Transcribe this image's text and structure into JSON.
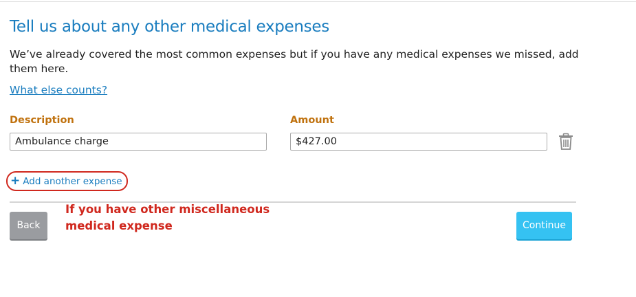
{
  "page": {
    "title": "Tell us about any other medical expenses",
    "intro": "We’ve already covered the most common expenses but if you have any medical expenses we missed, add them here.",
    "help_link": "What else counts?"
  },
  "form": {
    "description_label": "Description",
    "amount_label": "Amount",
    "description_value": "Ambulance charge",
    "amount_value": "$427.00",
    "delete_icon": "trash-icon",
    "add_icon": "plus-icon",
    "add_label": "Add another expense"
  },
  "annotation": {
    "text": "If you have other miscellaneous medical expense",
    "color": "#d0281e"
  },
  "footer": {
    "back_label": "Back",
    "continue_label": "Continue"
  },
  "colors": {
    "accent": "#1a7dbf",
    "label": "#c0720f",
    "continue_bg": "#35c2f2",
    "back_bg": "#9a9ca0"
  }
}
